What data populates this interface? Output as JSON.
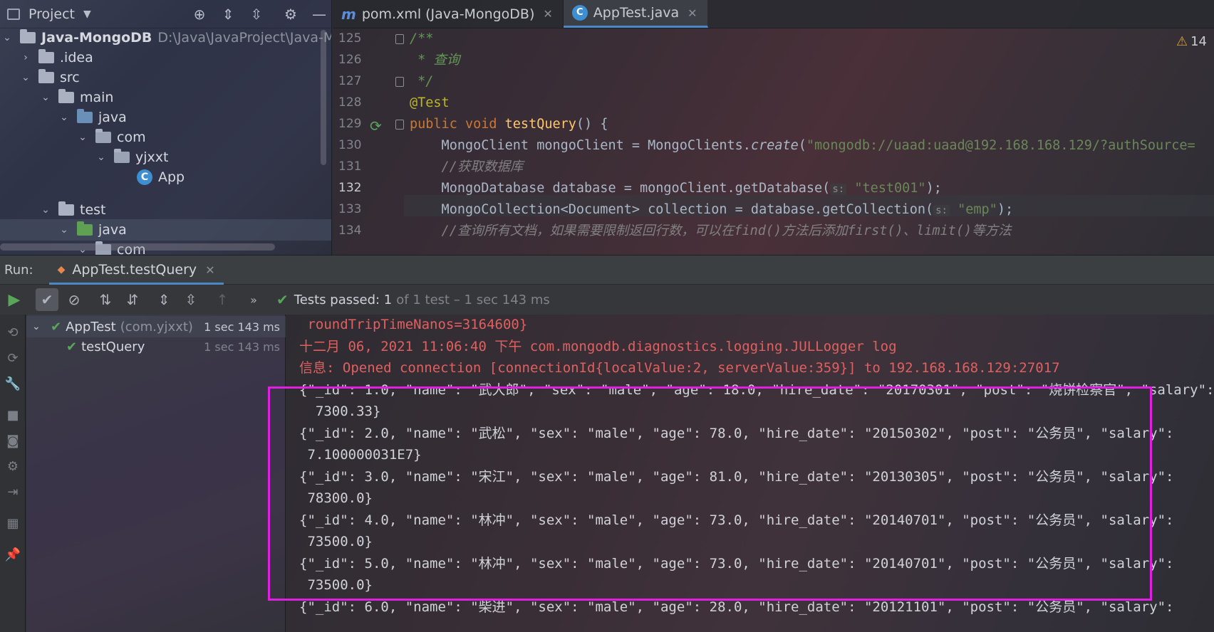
{
  "project_panel": {
    "title": "Project",
    "tree": [
      {
        "label": "Java-MongoDB",
        "path": "D:\\Java\\JavaProject\\Java-Mon",
        "arrow": "⌄"
      },
      {
        "label": ".idea",
        "arrow": "›"
      },
      {
        "label": "src",
        "arrow": "⌄"
      },
      {
        "label": "main",
        "arrow": "⌄"
      },
      {
        "label": "java",
        "arrow": "⌄"
      },
      {
        "label": "com",
        "arrow": "⌄"
      },
      {
        "label": "yjxxt",
        "arrow": "⌄"
      },
      {
        "label": "App"
      },
      {
        "label": "test",
        "arrow": "⌄"
      },
      {
        "label": "java",
        "arrow": "⌄"
      },
      {
        "label": "com",
        "arrow": "⌄"
      }
    ]
  },
  "editor": {
    "tabs": [
      {
        "label": "pom.xml (Java-MongoDB)",
        "icon": "m"
      },
      {
        "label": "AppTest.java",
        "icon": "c"
      }
    ],
    "warning_count": "14",
    "line_numbers": [
      "125",
      "126",
      "127",
      "128",
      "129",
      "130",
      "131",
      "132",
      "133",
      "134"
    ],
    "code": {
      "l125": "/**",
      "l126": " * 查询",
      "l127": " */",
      "l128": "@Test",
      "l129_kw": "public void ",
      "l129_fn": "testQuery",
      "l129_rest": "() {",
      "l130_a": "    MongoClient mongoClient = MongoClients.",
      "l130_b": "create",
      "l130_c": "(",
      "l130_str": "\"mongodb://uaad:uaad@192.168.168.129/?authSource=",
      "l131": "    //获取数据库",
      "l132_a": "    MongoDatabase database = mongoClient.getDatabase(",
      "l132_hint": "s:",
      "l132_str": "\"test001\"",
      "l132_end": ");",
      "l133_a": "    MongoCollection<Document> collection = database.getCollection(",
      "l133_hint": "s:",
      "l133_str": "\"emp\"",
      "l133_end": ");",
      "l134": "    //查询所有文档，如果需要限制返回行数，可以在find()方法后添加first()、limit()等方法"
    }
  },
  "run": {
    "label": "Run:",
    "tab_label": "AppTest.testQuery",
    "status_passed": "Tests passed: 1",
    "status_rest": "of 1 test – 1 sec 143 ms",
    "tree": [
      {
        "name": "AppTest",
        "pkg": "(com.yjxxt)",
        "time": "1 sec 143 ms"
      },
      {
        "name": "testQuery",
        "time": "1 sec 143 ms"
      }
    ]
  },
  "console": {
    "lines": [
      " roundTripTimeNanos=3164600}",
      "十二月 06, 2021 11:06:40 下午 com.mongodb.diagnostics.logging.JULLogger log",
      "信息: Opened connection [connectionId{localValue:2, serverValue:359}] to 192.168.168.129:27017",
      "{\"_id\": 1.0, \"name\": \"武大郎\", \"sex\": \"male\", \"age\": 18.0, \"hire_date\": \"20170301\", \"post\": \"烧饼检察官\", \"salary\":",
      "  7300.33}",
      "{\"_id\": 2.0, \"name\": \"武松\", \"sex\": \"male\", \"age\": 78.0, \"hire_date\": \"20150302\", \"post\": \"公务员\", \"salary\":",
      " 7.100000031E7}",
      "{\"_id\": 3.0, \"name\": \"宋江\", \"sex\": \"male\", \"age\": 81.0, \"hire_date\": \"20130305\", \"post\": \"公务员\", \"salary\":",
      " 78300.0}",
      "{\"_id\": 4.0, \"name\": \"林冲\", \"sex\": \"male\", \"age\": 73.0, \"hire_date\": \"20140701\", \"post\": \"公务员\", \"salary\":",
      " 73500.0}",
      "{\"_id\": 5.0, \"name\": \"林冲\", \"sex\": \"male\", \"age\": 73.0, \"hire_date\": \"20140701\", \"post\": \"公务员\", \"salary\":",
      " 73500.0}",
      "{\"_id\": 6.0, \"name\": \"柴进\", \"sex\": \"male\", \"age\": 28.0, \"hire_date\": \"20121101\", \"post\": \"公务员\", \"salary\":"
    ]
  },
  "colors": {
    "highlight": "#e020e0",
    "pass_green": "#59a65b",
    "console_red": "#e06060"
  }
}
